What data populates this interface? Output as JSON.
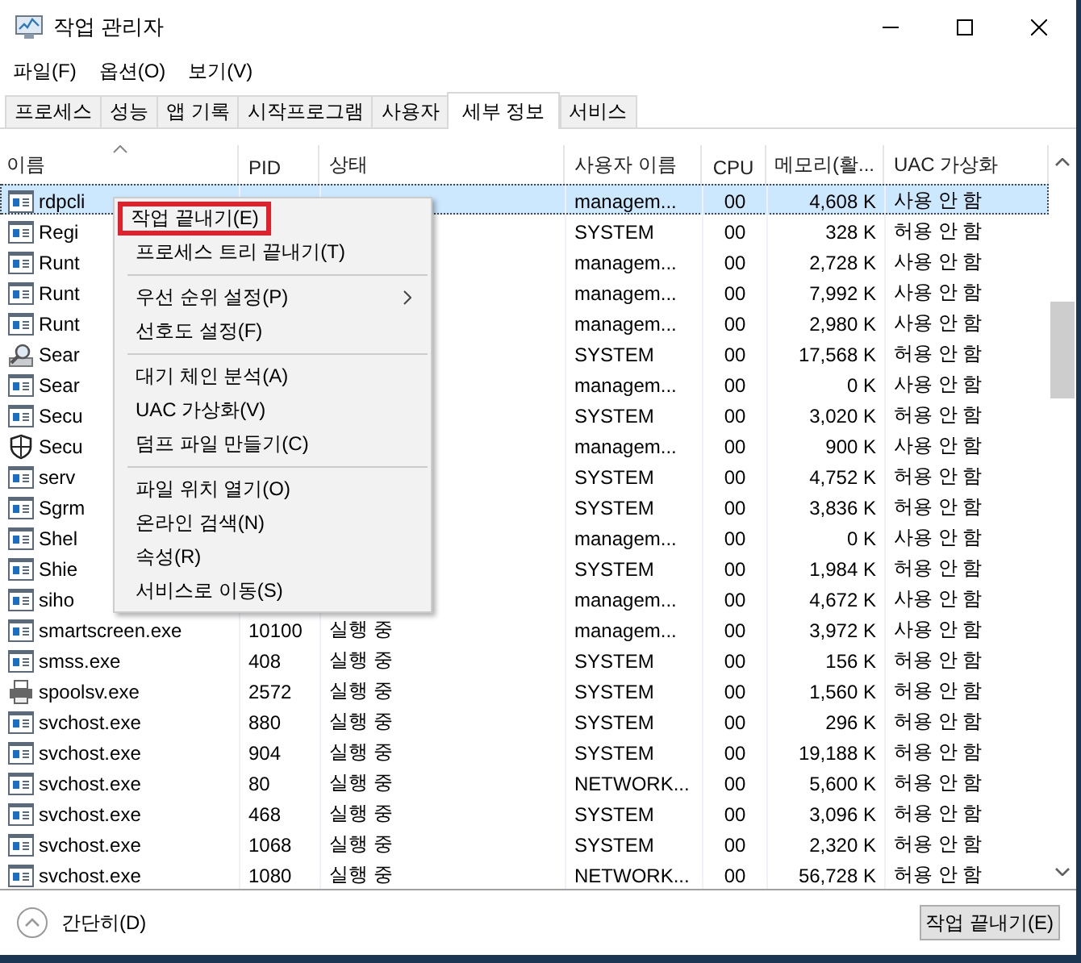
{
  "window": {
    "title": "작업 관리자"
  },
  "menu_bar": [
    "파일(F)",
    "옵션(O)",
    "보기(V)"
  ],
  "tabs": [
    {
      "label": "프로세스",
      "selected": false
    },
    {
      "label": "성능",
      "selected": false
    },
    {
      "label": "앱 기록",
      "selected": false
    },
    {
      "label": "시작프로그램",
      "selected": false
    },
    {
      "label": "사용자",
      "selected": false
    },
    {
      "label": "세부 정보",
      "selected": true
    },
    {
      "label": "서비스",
      "selected": false
    }
  ],
  "table": {
    "columns": [
      {
        "label": "이름",
        "sorted": true
      },
      {
        "label": "PID",
        "sorted": false
      },
      {
        "label": "상태",
        "sorted": false
      },
      {
        "label": "사용자 이름",
        "sorted": false
      },
      {
        "label": "CPU",
        "sorted": false
      },
      {
        "label": "메모리(활...",
        "sorted": false
      },
      {
        "label": "UAC 가상화",
        "sorted": false
      }
    ],
    "rows": [
      {
        "kind": "app",
        "selected": true,
        "name": "rdpcli",
        "user": "managem...",
        "cpu": "00",
        "memory": "4,608 K",
        "uac": "사용 안 함"
      },
      {
        "kind": "app",
        "selected": false,
        "name": "Regi",
        "user": "SYSTEM",
        "cpu": "00",
        "memory": "328 K",
        "uac": "허용 안 함"
      },
      {
        "kind": "app",
        "selected": false,
        "name": "Runt",
        "user": "managem...",
        "cpu": "00",
        "memory": "2,728 K",
        "uac": "사용 안 함"
      },
      {
        "kind": "app",
        "selected": false,
        "name": "Runt",
        "user": "managem...",
        "cpu": "00",
        "memory": "7,992 K",
        "uac": "사용 안 함"
      },
      {
        "kind": "app",
        "selected": false,
        "name": "Runt",
        "user": "managem...",
        "cpu": "00",
        "memory": "2,980 K",
        "uac": "사용 안 함"
      },
      {
        "kind": "search",
        "selected": false,
        "name": "Sear",
        "user": "SYSTEM",
        "cpu": "00",
        "memory": "17,568 K",
        "uac": "허용 안 함"
      },
      {
        "kind": "app",
        "selected": false,
        "name": "Sear",
        "user": "managem...",
        "cpu": "00",
        "memory": "0 K",
        "uac": "사용 안 함"
      },
      {
        "kind": "app",
        "selected": false,
        "name": "Secu",
        "user": "SYSTEM",
        "cpu": "00",
        "memory": "3,020 K",
        "uac": "허용 안 함"
      },
      {
        "kind": "shield",
        "selected": false,
        "name": "Secu",
        "user": "managem...",
        "cpu": "00",
        "memory": "900 K",
        "uac": "사용 안 함"
      },
      {
        "kind": "app",
        "selected": false,
        "name": "serv",
        "user": "SYSTEM",
        "cpu": "00",
        "memory": "4,752 K",
        "uac": "허용 안 함"
      },
      {
        "kind": "app",
        "selected": false,
        "name": "Sgrm",
        "user": "SYSTEM",
        "cpu": "00",
        "memory": "3,836 K",
        "uac": "허용 안 함"
      },
      {
        "kind": "app",
        "selected": false,
        "name": "Shel",
        "user": "managem...",
        "cpu": "00",
        "memory": "0 K",
        "uac": "사용 안 함"
      },
      {
        "kind": "app",
        "selected": false,
        "name": "Shie",
        "user": "SYSTEM",
        "cpu": "00",
        "memory": "1,984 K",
        "uac": "허용 안 함"
      },
      {
        "kind": "app",
        "selected": false,
        "name": "siho",
        "user": "managem...",
        "cpu": "00",
        "memory": "4,672 K",
        "uac": "사용 안 함"
      },
      {
        "kind": "app",
        "selected": false,
        "name": "smartscreen.exe",
        "pid": "10100",
        "status": "실행 중",
        "user": "managem...",
        "cpu": "00",
        "memory": "3,972 K",
        "uac": "사용 안 함"
      },
      {
        "kind": "app",
        "selected": false,
        "name": "smss.exe",
        "pid": "408",
        "status": "실행 중",
        "user": "SYSTEM",
        "cpu": "00",
        "memory": "156 K",
        "uac": "허용 안 함"
      },
      {
        "kind": "printer",
        "selected": false,
        "name": "spoolsv.exe",
        "pid": "2572",
        "status": "실행 중",
        "user": "SYSTEM",
        "cpu": "00",
        "memory": "1,560 K",
        "uac": "허용 안 함"
      },
      {
        "kind": "app",
        "selected": false,
        "name": "svchost.exe",
        "pid": "880",
        "status": "실행 중",
        "user": "SYSTEM",
        "cpu": "00",
        "memory": "296 K",
        "uac": "허용 안 함"
      },
      {
        "kind": "app",
        "selected": false,
        "name": "svchost.exe",
        "pid": "904",
        "status": "실행 중",
        "user": "SYSTEM",
        "cpu": "00",
        "memory": "19,188 K",
        "uac": "허용 안 함"
      },
      {
        "kind": "app",
        "selected": false,
        "name": "svchost.exe",
        "pid": "80",
        "status": "실행 중",
        "user": "NETWORK...",
        "cpu": "00",
        "memory": "5,600 K",
        "uac": "허용 안 함"
      },
      {
        "kind": "app",
        "selected": false,
        "name": "svchost.exe",
        "pid": "468",
        "status": "실행 중",
        "user": "SYSTEM",
        "cpu": "00",
        "memory": "3,096 K",
        "uac": "허용 안 함"
      },
      {
        "kind": "app",
        "selected": false,
        "name": "svchost.exe",
        "pid": "1068",
        "status": "실행 중",
        "user": "SYSTEM",
        "cpu": "00",
        "memory": "2,320 K",
        "uac": "허용 안 함"
      },
      {
        "kind": "app",
        "selected": false,
        "name": "svchost.exe",
        "pid": "1080",
        "status": "실행 중",
        "user": "NETWORK...",
        "cpu": "00",
        "memory": "56,728 K",
        "uac": "허용 안 함"
      }
    ]
  },
  "context_menu": {
    "groups": [
      [
        {
          "label": "작업 끝내기(E)",
          "highlighted": true,
          "submenu": false
        },
        {
          "label": "프로세스 트리 끝내기(T)",
          "highlighted": false,
          "submenu": false
        }
      ],
      [
        {
          "label": "우선 순위 설정(P)",
          "highlighted": false,
          "submenu": true
        },
        {
          "label": "선호도 설정(F)",
          "highlighted": false,
          "submenu": false
        }
      ],
      [
        {
          "label": "대기 체인 분석(A)",
          "highlighted": false,
          "submenu": false
        },
        {
          "label": "UAC 가상화(V)",
          "highlighted": false,
          "submenu": false
        },
        {
          "label": "덤프 파일 만들기(C)",
          "highlighted": false,
          "submenu": false
        }
      ],
      [
        {
          "label": "파일 위치 열기(O)",
          "highlighted": false,
          "submenu": false
        },
        {
          "label": "온라인 검색(N)",
          "highlighted": false,
          "submenu": false
        },
        {
          "label": "속성(R)",
          "highlighted": false,
          "submenu": false
        },
        {
          "label": "서비스로 이동(S)",
          "highlighted": false,
          "submenu": false
        }
      ]
    ]
  },
  "footer": {
    "collapse_link": "간단히(D)",
    "end_task_button": "작업 끝내기(E)"
  }
}
